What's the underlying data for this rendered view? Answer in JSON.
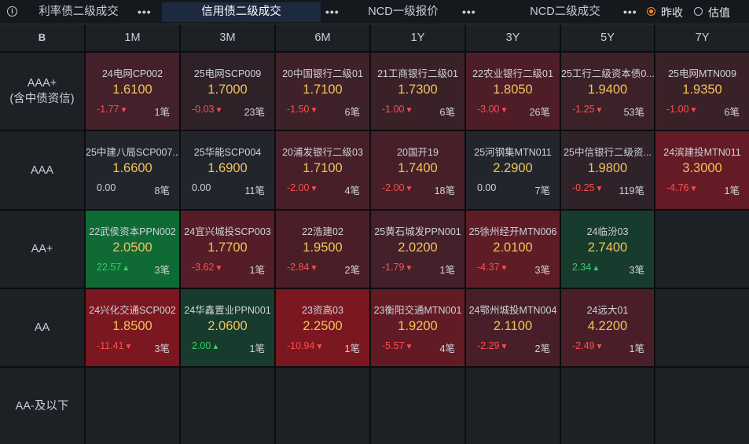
{
  "tabs": [
    {
      "label": "利率债二级成交",
      "menu": "•••"
    },
    {
      "label": "信用债二级成交",
      "menu": "•••"
    },
    {
      "label": "NCD一级报价",
      "menu": "•••"
    },
    {
      "label": "NCD二级成交",
      "menu": "•••"
    }
  ],
  "active_tab": 1,
  "radio_options": [
    {
      "label": "昨收",
      "checked": true
    },
    {
      "label": "估值",
      "checked": false
    }
  ],
  "info_icon": "i",
  "corner_icon": "B",
  "columns": [
    "1M",
    "3M",
    "6M",
    "1Y",
    "3Y",
    "5Y",
    "7Y"
  ],
  "rows": [
    {
      "label": "AAA+\n(含中债资信)",
      "cells": [
        {
          "name": "24电网CP002",
          "yield": "1.6100",
          "change": "-1.77",
          "dir": "down",
          "count": "1笔",
          "bg": "#43202a"
        },
        {
          "name": "25电网SCP009",
          "yield": "1.7000",
          "change": "-0.03",
          "dir": "down",
          "count": "23笔",
          "bg": "#2e2228"
        },
        {
          "name": "20中国银行二级01",
          "yield": "1.7100",
          "change": "-1.50",
          "dir": "down",
          "count": "6笔",
          "bg": "#3f2129"
        },
        {
          "name": "21工商银行二级01",
          "yield": "1.7300",
          "change": "-1.00",
          "dir": "down",
          "count": "6笔",
          "bg": "#3a2128"
        },
        {
          "name": "22农业银行二级01",
          "yield": "1.8050",
          "change": "-3.00",
          "dir": "down",
          "count": "26笔",
          "bg": "#4e1d27"
        },
        {
          "name": "25工行二级资本债0...",
          "yield": "1.9400",
          "change": "-1.25",
          "dir": "down",
          "count": "53笔",
          "bg": "#3d2128"
        },
        {
          "name": "25电网MTN009",
          "yield": "1.9350",
          "change": "-1.00",
          "dir": "down",
          "count": "6笔",
          "bg": "#3a2128"
        }
      ]
    },
    {
      "label": "AAA",
      "cells": [
        {
          "name": "25中建八局SCP007...",
          "yield": "1.6600",
          "change": "0.00",
          "dir": "flat",
          "count": "8笔",
          "bg": "#22262c"
        },
        {
          "name": "25华能SCP004",
          "yield": "1.6900",
          "change": "0.00",
          "dir": "flat",
          "count": "11笔",
          "bg": "#22262c"
        },
        {
          "name": "20浦发银行二级03",
          "yield": "1.7100",
          "change": "-2.00",
          "dir": "down",
          "count": "4笔",
          "bg": "#461f28"
        },
        {
          "name": "20国开19",
          "yield": "1.7400",
          "change": "-2.00",
          "dir": "down",
          "count": "18笔",
          "bg": "#461f28"
        },
        {
          "name": "25河钢集MTN011",
          "yield": "2.2900",
          "change": "0.00",
          "dir": "flat",
          "count": "7笔",
          "bg": "#22262c"
        },
        {
          "name": "25中信银行二级资...",
          "yield": "1.9800",
          "change": "-0.25",
          "dir": "down",
          "count": "119笔",
          "bg": "#2f2228"
        },
        {
          "name": "24滨建投MTN011",
          "yield": "3.3000",
          "change": "-4.76",
          "dir": "down",
          "count": "1笔",
          "bg": "#651b25"
        }
      ]
    },
    {
      "label": "AA+",
      "cells": [
        {
          "name": "22武侯资本PPN002",
          "yield": "2.0500",
          "change": "22.57",
          "dir": "up",
          "count": "3笔",
          "bg": "#0f6a35"
        },
        {
          "name": "24宜兴城投SCP003",
          "yield": "1.7700",
          "change": "-3.62",
          "dir": "down",
          "count": "1笔",
          "bg": "#541d27"
        },
        {
          "name": "22浩建02",
          "yield": "1.9500",
          "change": "-2.84",
          "dir": "down",
          "count": "2笔",
          "bg": "#4b1e27"
        },
        {
          "name": "25黄石城发PPN001",
          "yield": "2.0200",
          "change": "-1.79",
          "dir": "down",
          "count": "1笔",
          "bg": "#43202a"
        },
        {
          "name": "25徐州经开MTN006",
          "yield": "2.0100",
          "change": "-4.37",
          "dir": "down",
          "count": "3笔",
          "bg": "#5e1c26"
        },
        {
          "name": "24临汾03",
          "yield": "2.7400",
          "change": "2.34",
          "dir": "up",
          "count": "3笔",
          "bg": "#173b2c"
        },
        null
      ]
    },
    {
      "label": "AA",
      "cells": [
        {
          "name": "24兴化交通SCP002",
          "yield": "1.8500",
          "change": "-11.41",
          "dir": "down",
          "count": "3笔",
          "bg": "#7a1720"
        },
        {
          "name": "24华鑫置业PPN001",
          "yield": "2.0600",
          "change": "2.00",
          "dir": "up",
          "count": "1笔",
          "bg": "#173b2c"
        },
        {
          "name": "23资高03",
          "yield": "2.2500",
          "change": "-10.94",
          "dir": "down",
          "count": "1笔",
          "bg": "#7a1720"
        },
        {
          "name": "23衡阳交通MTN001",
          "yield": "1.9200",
          "change": "-5.57",
          "dir": "down",
          "count": "4笔",
          "bg": "#621b25"
        },
        {
          "name": "24鄂州城投MTN004",
          "yield": "2.1100",
          "change": "-2.29",
          "dir": "down",
          "count": "2笔",
          "bg": "#481f28"
        },
        {
          "name": "24远大01",
          "yield": "4.2200",
          "change": "-2.49",
          "dir": "down",
          "count": "1笔",
          "bg": "#4a1e28"
        },
        null
      ]
    },
    {
      "label": "AA-及以下",
      "cells": [
        null,
        null,
        null,
        null,
        null,
        null,
        null
      ]
    }
  ],
  "colors": {
    "up": "#2fd36a",
    "down": "#ff4d4d",
    "yield": "#f2c35a",
    "accent": "#ff8a1f"
  }
}
